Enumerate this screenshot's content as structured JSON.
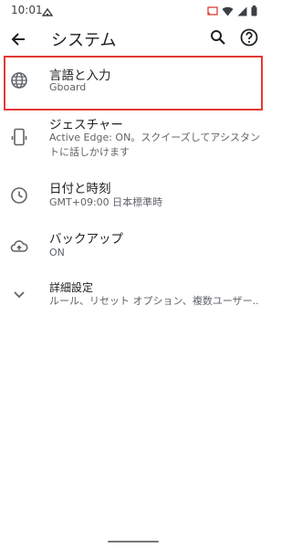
{
  "status_bar": {
    "time": "10:01"
  },
  "app_bar": {
    "title": "システム"
  },
  "items": [
    {
      "title": "言語と入力",
      "summary": "Gboard",
      "icon": "globe-icon"
    },
    {
      "title": "ジェスチャー",
      "summary": "Active Edge: ON。スクイーズしてアシスタントに話しかけます",
      "icon": "gesture-phone-icon"
    },
    {
      "title": "日付と時刻",
      "summary": "GMT+09:00 日本標準時",
      "icon": "clock-icon"
    },
    {
      "title": "バックアップ",
      "summary": "ON",
      "icon": "cloud-upload-icon"
    },
    {
      "title": "詳細設定",
      "summary": "ルール、リセット オプション、複数ユーザー..",
      "icon": "chevron-down-icon"
    }
  ],
  "colors": {
    "highlight": "#e53935",
    "text_primary": "#202124",
    "text_secondary": "#5f6368"
  }
}
